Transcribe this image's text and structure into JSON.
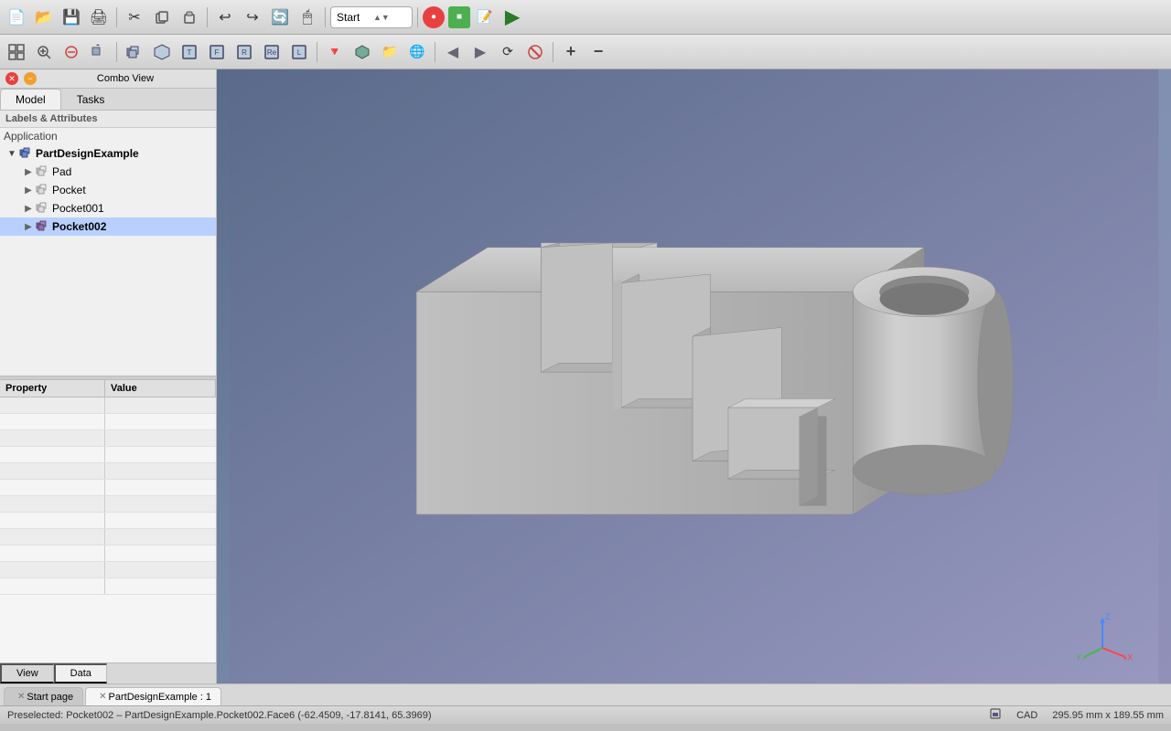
{
  "toolbar1": {
    "buttons": [
      {
        "name": "new",
        "icon": "📄"
      },
      {
        "name": "open",
        "icon": "📂"
      },
      {
        "name": "save",
        "icon": "💾"
      },
      {
        "name": "print",
        "icon": "🖨"
      },
      {
        "name": "cut",
        "icon": "✂"
      },
      {
        "name": "copy",
        "icon": "📋"
      },
      {
        "name": "paste",
        "icon": "📌"
      },
      {
        "name": "undo",
        "icon": "↩"
      },
      {
        "name": "redo",
        "icon": "↪"
      },
      {
        "name": "refresh",
        "icon": "🔄"
      },
      {
        "name": "pointer",
        "icon": "🖱"
      }
    ],
    "workbench_label": "Start",
    "macro_record_label": "●",
    "macro_stop_label": "■",
    "macro_edit_label": "📝",
    "macro_run_label": "▶"
  },
  "toolbar2": {
    "buttons": [
      {
        "name": "fit-all",
        "icon": "⊞"
      },
      {
        "name": "zoom-in",
        "icon": "🔍"
      },
      {
        "name": "box-select",
        "icon": "⊟"
      },
      {
        "name": "rotate-view",
        "icon": "🔁"
      },
      {
        "name": "home",
        "icon": "⌂"
      },
      {
        "name": "isometric",
        "icon": "◫"
      },
      {
        "name": "top",
        "icon": "▣"
      },
      {
        "name": "front",
        "icon": "▤"
      },
      {
        "name": "right",
        "icon": "▥"
      },
      {
        "name": "rear",
        "icon": "▦"
      },
      {
        "name": "left",
        "icon": "▧"
      },
      {
        "name": "select-filter",
        "icon": "🔻"
      },
      {
        "name": "part-design",
        "icon": "⬡"
      },
      {
        "name": "folder",
        "icon": "📁"
      },
      {
        "name": "globe",
        "icon": "🌐"
      },
      {
        "name": "back-nav",
        "icon": "←"
      },
      {
        "name": "fwd-nav",
        "icon": "→"
      },
      {
        "name": "refresh-nav",
        "icon": "⟳"
      },
      {
        "name": "stop-nav",
        "icon": "✕"
      },
      {
        "name": "zoom-in2",
        "icon": "+"
      },
      {
        "name": "zoom-out2",
        "icon": "−"
      }
    ]
  },
  "combo_view": {
    "title": "Combo View",
    "tabs": [
      "Model",
      "Tasks"
    ]
  },
  "model_tree": {
    "section_label": "Labels & Attributes",
    "root_label": "Application",
    "items": [
      {
        "id": "part-design-example",
        "label": "PartDesignExample",
        "icon": "🟦",
        "level": 0,
        "expanded": true,
        "bold": true
      },
      {
        "id": "pad",
        "label": "Pad",
        "icon": "⬜",
        "level": 1,
        "expanded": false,
        "bold": false
      },
      {
        "id": "pocket",
        "label": "Pocket",
        "icon": "⬜",
        "level": 1,
        "expanded": false,
        "bold": false
      },
      {
        "id": "pocket001",
        "label": "Pocket001",
        "icon": "⬜",
        "level": 1,
        "expanded": false,
        "bold": false
      },
      {
        "id": "pocket002",
        "label": "Pocket002",
        "icon": "🟪",
        "level": 1,
        "expanded": false,
        "bold": true,
        "selected": true
      }
    ]
  },
  "property_panel": {
    "col_property": "Property",
    "col_value": "Value",
    "rows": []
  },
  "left_bottom_tabs": [
    "View",
    "Data"
  ],
  "bottom_tabs": [
    {
      "label": "Start page",
      "closable": true,
      "active": false
    },
    {
      "label": "PartDesignExample : 1",
      "closable": true,
      "active": true
    }
  ],
  "statusbar": {
    "left": "Preselected: Pocket002 – PartDesignExample.Pocket002.Face6 (-62.4509, -17.8141, 65.3969)",
    "mode": "CAD",
    "dimensions": "295.95 mm x 189.55 mm"
  },
  "viewport": {
    "bg_top": "#5a6a8a",
    "bg_bottom": "#9898c0"
  }
}
